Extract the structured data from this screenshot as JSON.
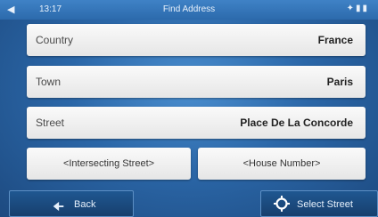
{
  "status": {
    "clock": "13:17",
    "title": "Find Address"
  },
  "form": {
    "country": {
      "label": "Country",
      "value": "France"
    },
    "town": {
      "label": "Town",
      "value": "Paris"
    },
    "street": {
      "label": "Street",
      "value": "Place De La Concorde"
    }
  },
  "buttons": {
    "intersecting": "<Intersecting Street>",
    "house": "<House Number>"
  },
  "footer": {
    "back": "Back",
    "select": "Select Street"
  }
}
